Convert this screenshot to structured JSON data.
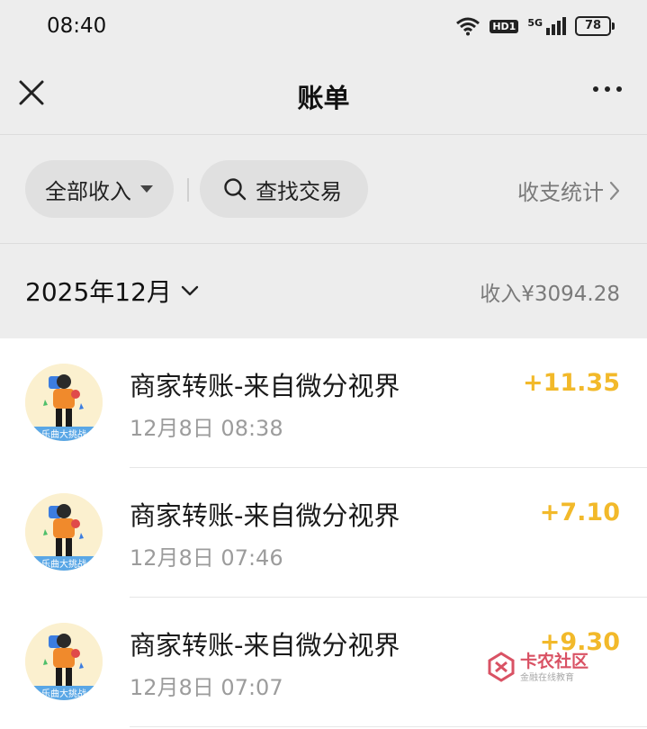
{
  "status_bar": {
    "time": "08:40",
    "hd_label": "HD1",
    "network_label": "5G",
    "battery": "78",
    "icons": [
      "wifi-icon",
      "hd-icon",
      "signal-5g-icon",
      "battery-icon"
    ]
  },
  "nav": {
    "title": "账单",
    "close_icon": "close-icon",
    "more_icon": "more-icon"
  },
  "filters": {
    "income_label": "全部收入",
    "search_label": "查找交易",
    "stats_label": "收支统计"
  },
  "month": {
    "label": "2025年12月",
    "summary": "收入¥3094.28"
  },
  "transactions": [
    {
      "title": "商家转账-来自微分视界",
      "time": "12月8日 08:38",
      "amount": "+11.35",
      "avatar_text": "乐曲大挑战"
    },
    {
      "title": "商家转账-来自微分视界",
      "time": "12月8日 07:46",
      "amount": "+7.10",
      "avatar_text": "乐曲大挑战"
    },
    {
      "title": "商家转账-来自微分视界",
      "time": "12月8日 07:07",
      "amount": "+9.30",
      "avatar_text": "乐曲大挑战"
    }
  ],
  "watermark": {
    "title": "卡农社区",
    "subtitle": "金融在线教育"
  },
  "colors": {
    "background": "#ededed",
    "list_background": "#ffffff",
    "amount": "#f2b92a",
    "secondary_text": "#7a7a7a"
  }
}
